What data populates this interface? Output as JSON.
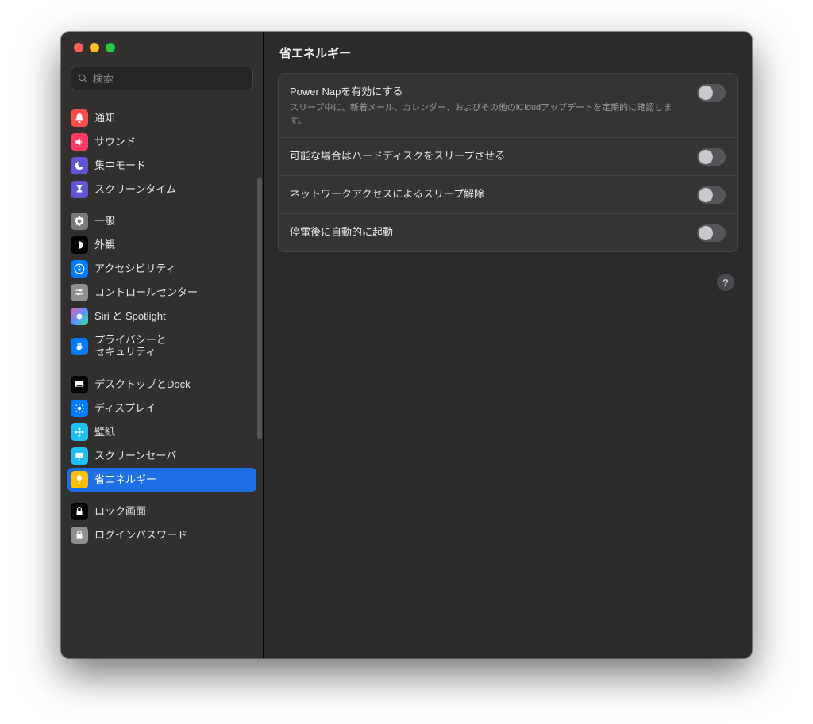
{
  "search": {
    "placeholder": "検索"
  },
  "sidebar": {
    "groups": [
      {
        "items": [
          {
            "label": "通知"
          },
          {
            "label": "サウンド"
          },
          {
            "label": "集中モード"
          },
          {
            "label": "スクリーンタイム"
          }
        ]
      },
      {
        "items": [
          {
            "label": "一般"
          },
          {
            "label": "外観"
          },
          {
            "label": "アクセシビリティ"
          },
          {
            "label": "コントロールセンター"
          },
          {
            "label": "Siri と Spotlight"
          },
          {
            "label": "プライバシーと\nセキュリティ"
          }
        ]
      },
      {
        "items": [
          {
            "label": "デスクトップとDock"
          },
          {
            "label": "ディスプレイ"
          },
          {
            "label": "壁紙"
          },
          {
            "label": "スクリーンセーバ"
          },
          {
            "label": "省エネルギー"
          }
        ]
      },
      {
        "items": [
          {
            "label": "ロック画面"
          },
          {
            "label": "ログインパスワード"
          }
        ]
      }
    ]
  },
  "header": {
    "title": "省エネルギー"
  },
  "settings": [
    {
      "title": "Power Napを有効にする",
      "desc": "スリープ中に、新着メール、カレンダー、およびその他のiCloudアップデートを定期的に確認します。"
    },
    {
      "title": "可能な場合はハードディスクをスリープさせる"
    },
    {
      "title": "ネットワークアクセスによるスリープ解除"
    },
    {
      "title": "停電後に自動的に起動"
    }
  ],
  "help": {
    "label": "?"
  }
}
